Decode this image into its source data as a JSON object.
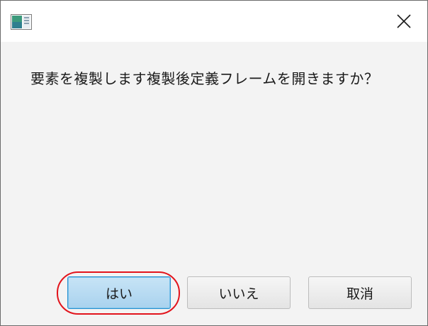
{
  "titlebar": {
    "icon": "window-app-icon",
    "close_icon": "close-icon"
  },
  "dialog": {
    "message": "要素を複製します複製後定義フレームを開きますか？"
  },
  "buttons": {
    "yes_label": "はい",
    "no_label": "いいえ",
    "cancel_label": "取消"
  },
  "colors": {
    "accent_border": "#2b92d1",
    "annotation_red": "#e2141c"
  }
}
